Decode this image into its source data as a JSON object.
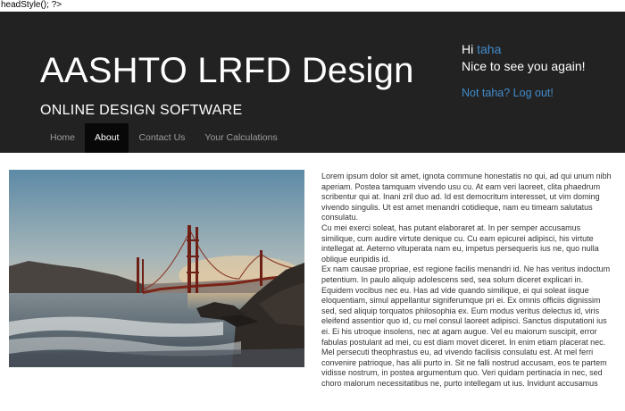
{
  "debug_text": "headStyle(); ?>",
  "header": {
    "title": "AASHTO LRFD Design",
    "subtitle": "ONLINE DESIGN SOFTWARE"
  },
  "user": {
    "greeting_prefix": "Hi ",
    "username": "taha",
    "welcome": "Nice to see you again!",
    "logout": "Not taha? Log out!"
  },
  "nav": {
    "items": [
      {
        "label": "Home"
      },
      {
        "label": "About"
      },
      {
        "label": "Contact Us"
      },
      {
        "label": "Your Calculations"
      }
    ],
    "active": "About"
  },
  "content": {
    "paragraphs": [
      "Lorem ipsum dolor sit amet, ignota commune honestatis no qui, ad qui unum nibh aperiam. Postea tamquam vivendo usu cu. At eam veri laoreet, clita phaedrum scribentur qui at. Inani zril duo ad. Id est democritum interesset, ut vim doming vivendo singulis. Ut est amet menandri cotidieque, nam eu timeam salutatus consulatu.",
      "Cu mei exerci soleat, has putant elaboraret at. In per semper accusamus similique, cum audire virtute denique cu. Cu eam epicurei adipisci, his virtute intellegat at. Aeterno vituperata nam eu, impetus persequeris ius ne, quo nulla oblique euripidis id.",
      "Ex nam causae propriae, est regione facilis menandri id. Ne has veritus indoctum petentium. In paulo aliquip adolescens sed, sea solum diceret explicari in. Equidem vocibus nec eu. Has ad vide quando similique, ei qui soleat iisque eloquentiam, simul appellantur signiferumque pri ei. Ex omnis officiis dignissim sed, sed aliquip torquatos philosophia ex. Eum modus veritus delectus id, viris eleifend assentior quo id, cu mel consul laoreet adipisci. Sanctus disputationi ius ei. Ei his utroque insolens, nec at agam augue. Vel eu maiorum suscipit, error fabulas postulant ad mei, cu est diam movet diceret. In enim etiam placerat nec. Mel persecuti theophrastus eu, ad vivendo facilisis consulatu est. At mel ferri convenire patrioque, has alii purto in. Sit ne falli nostrud accusam, eos te partem vidisse nostrum, in postea argumentum quo. Veri quidam pertinacia in nec, sed choro malorum necessitatibus ne, purto intellegam ut ius. Invidunt accusamus"
    ]
  }
}
